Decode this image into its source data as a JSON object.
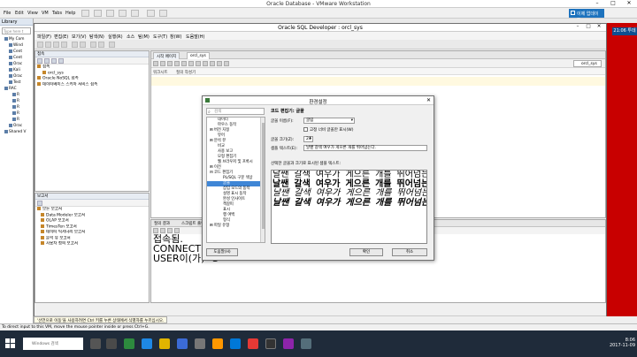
{
  "host": {
    "title": "Oracle Database - VMware Workstation",
    "menu": [
      "File",
      "Edit",
      "View",
      "VM",
      "Tabs",
      "Help"
    ],
    "badge": "이제 업데이트",
    "status": "To direct input to this VM, move the mouse pointer inside or press Ctrl+G."
  },
  "library": {
    "title": "Library",
    "search_placeholder": "Type here t",
    "items": [
      "My Com",
      "Wind",
      "Cent",
      "Cent",
      "Orac",
      "Kali",
      "Orac",
      "Test",
      "RAC",
      "R",
      "R",
      "R",
      "R",
      "R",
      "Orac",
      "Shared V"
    ]
  },
  "guest": {
    "clock": "21:06 투데"
  },
  "sqldev": {
    "title": "Oracle SQL Developer : orcl_sys",
    "menu": [
      "파일(F)",
      "편집(E)",
      "보기(V)",
      "탐색(N)",
      "실행(R)",
      "소스",
      "팀(M)",
      "도구(T)",
      "창(W)",
      "도움말(H)"
    ],
    "connections": {
      "title": "접속",
      "items": [
        "접속",
        "orcl_sys",
        "Oracle NoSQL 접속",
        "데이터베이스 스키마 서비스 접속"
      ]
    },
    "reports": {
      "title": "보고서",
      "items": [
        "모든 보고서",
        "Data Modeler 보고서",
        "OLAP 보고서",
        "TimesTen 보고서",
        "데이터 딕셔너리 보고서",
        "분석 뷰 보고서",
        "사용자 정의 보고서"
      ]
    },
    "editor": {
      "tabs": [
        "시작 페이지",
        "orcl_sys"
      ],
      "connection": "orcl_sys",
      "subtabs": [
        "워크시트",
        "질의 작성기"
      ]
    },
    "output": {
      "tabs": [
        "질의 결과",
        "스크립트 출력"
      ],
      "lines": [
        "접속됨.",
        "CONNECT 스크",
        "USER이(가) \"S"
      ]
    },
    "tooltip": "'선언으로 이동'을 사용하려면 Ctrl 키를 누른 상태에서 식별자를 누르십시오."
  },
  "prefs": {
    "title": "환경설정",
    "search_placeholder": "검색",
    "tree": [
      {
        "label": "데이터",
        "level": 2,
        "selected": false
      },
      {
        "label": "마우스 동작",
        "level": 2,
        "selected": false
      },
      {
        "label": "버전 지정",
        "level": 1,
        "selected": false
      },
      {
        "label": "뷰어",
        "level": 2,
        "selected": false
      },
      {
        "label": "분석 뷰",
        "level": 1,
        "selected": false
      },
      {
        "label": "비교",
        "level": 2,
        "selected": false
      },
      {
        "label": "사용 보고",
        "level": 2,
        "selected": false
      },
      {
        "label": "모형 편집기",
        "level": 2,
        "selected": false
      },
      {
        "label": "웹 브라우저 및 프록시",
        "level": 2,
        "selected": false
      },
      {
        "label": "이전",
        "level": 1,
        "selected": false
      },
      {
        "label": "코드 편집기",
        "level": 1,
        "selected": false
      },
      {
        "label": "PL/SQL 구문 색상",
        "level": 3,
        "selected": false
      },
      {
        "label": "글꼴",
        "level": 3,
        "selected": true
      },
      {
        "label": "삽입 모드의 동작",
        "level": 3,
        "selected": false
      },
      {
        "label": "설명 표시 동작",
        "level": 3,
        "selected": false
      },
      {
        "label": "완성 인사이트",
        "level": 3,
        "selected": false
      },
      {
        "label": "책갈피",
        "level": 3,
        "selected": false
      },
      {
        "label": "표시",
        "level": 3,
        "selected": false
      },
      {
        "label": "행 여백",
        "level": 3,
        "selected": false
      },
      {
        "label": "형식",
        "level": 3,
        "selected": false
      },
      {
        "label": "파일 유형",
        "level": 1,
        "selected": false
      }
    ],
    "heading": "코드 편집기: 글꼴",
    "font_name_label": "글꼴 이름(F):",
    "font_name_value": "굴림",
    "fixed_width_label": "고정 너비 글꼴만 표시(W)",
    "font_size_label": "글꼴 크기(Z):",
    "font_size_value": "24",
    "sample_label": "샘플 텍스트(E):",
    "sample_value": "날쌘 갈색 여우가 게으른 개를 뛰어넘는다.",
    "preview_label": "선택한 글꼴과 크기로 표시된 샘플 텍스트:",
    "preview_lines": [
      "날쌘 갈색 여우가 게으른 개를 뛰어넘는다.",
      "날쌘 갈색 여우가 게으른 개를 뛰어넘는다",
      "날쌘 갈색 여우가 게으른 개를 뛰어넘는다.",
      "날쌘 갈색 여우가 게으른 개를 뛰어넘는다"
    ],
    "help_button": "도움말(H)",
    "ok_button": "확인",
    "cancel_button": "취소"
  },
  "taskbar": {
    "search_placeholder": "Windows 검색",
    "time": "8:06",
    "date": "2017-11-09"
  }
}
